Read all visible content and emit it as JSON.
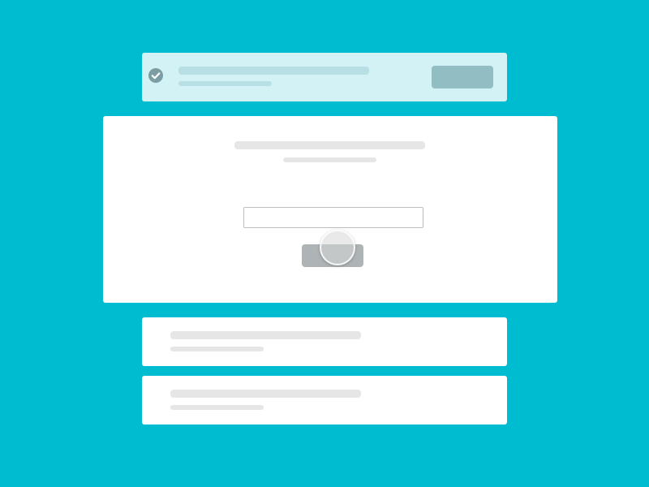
{
  "banner": {
    "icon": "check-circle-icon",
    "status_color": "#7A9EA3",
    "action_button_label": ""
  },
  "form": {
    "input_value": "",
    "input_placeholder": "",
    "submit_label": ""
  },
  "list": {
    "items": [
      {
        "title": "",
        "subtitle": ""
      },
      {
        "title": "",
        "subtitle": ""
      }
    ]
  },
  "colors": {
    "background": "#00BCD0",
    "banner_background": "#D3F2F6",
    "card_background": "#FFFFFF",
    "placeholder_bar": "#E6E6E6"
  }
}
